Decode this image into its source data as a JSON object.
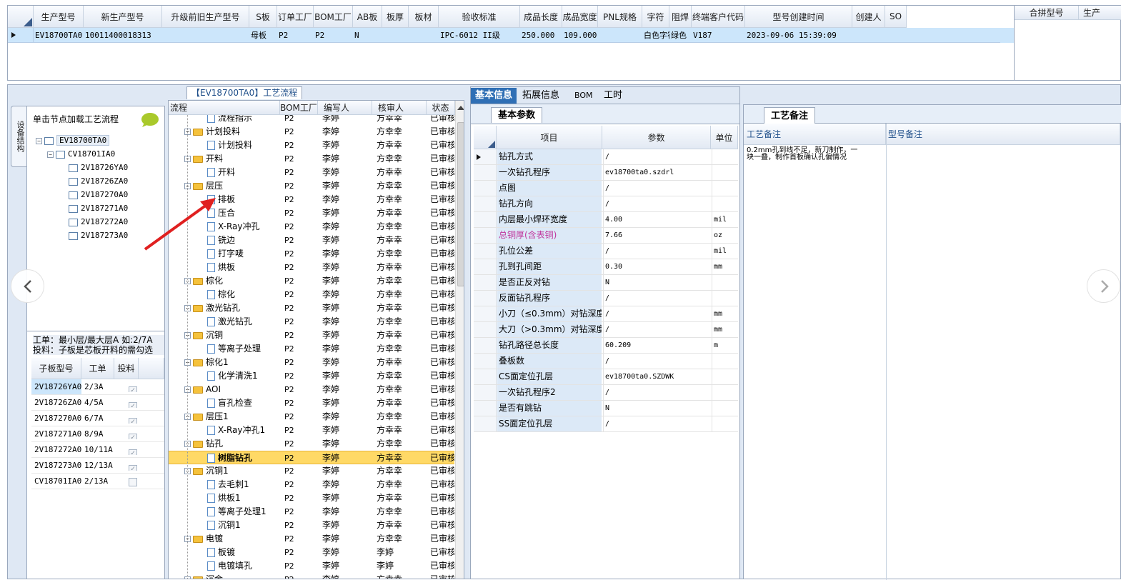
{
  "top": {
    "columns": [
      "生产型号",
      "新生产型号",
      "升级前旧生产型号",
      "S板",
      "订单工厂",
      "BOM工厂",
      "AB板",
      "板厚",
      "板材",
      "验收标准",
      "成品长度",
      "成品宽度",
      "PNL规格",
      "字符",
      "阻焊",
      "终端客户代码",
      "型号创建时间",
      "创建人",
      "SO"
    ],
    "row": [
      "EV18700TA0",
      "10011400018313",
      "",
      "母板",
      "P2",
      "P2",
      "N",
      "",
      "",
      "IPC-6012 II级",
      "250.000",
      "109.000",
      "",
      "白色字符",
      "绿色",
      "V187",
      "2023-09-06 15:39:09",
      "",
      ""
    ],
    "side_columns": [
      "合拼型号",
      "生产"
    ]
  },
  "left": {
    "vertical_tab": "设备结构",
    "hint": "单击节点加载工艺流程",
    "tree": [
      {
        "label": "EV18700TA0",
        "level": 0
      },
      {
        "label": "CV18701IA0",
        "level": 1
      },
      {
        "label": "2V18726YA0",
        "level": 2
      },
      {
        "label": "2V18726ZA0",
        "level": 2
      },
      {
        "label": "2V187270A0",
        "level": 2
      },
      {
        "label": "2V187271A0",
        "level": 2
      },
      {
        "label": "2V187272A0",
        "level": 2
      },
      {
        "label": "2V187273A0",
        "level": 2
      }
    ],
    "note_line1": "工单：最小层/最大层A 如:2/7A",
    "note_line2": "投料：子板是芯板开料的需勾选",
    "sub_columns": [
      "子板型号",
      "工单",
      "投料"
    ],
    "sub_rows": [
      {
        "model": "2V18726YA0",
        "order": "2/3A",
        "checked": true
      },
      {
        "model": "2V18726ZA0",
        "order": "4/5A",
        "checked": true
      },
      {
        "model": "2V187270A0",
        "order": "6/7A",
        "checked": true
      },
      {
        "model": "2V187271A0",
        "order": "8/9A",
        "checked": true
      },
      {
        "model": "2V187272A0",
        "order": "10/11A",
        "checked": true
      },
      {
        "model": "2V187273A0",
        "order": "12/13A",
        "checked": true
      },
      {
        "model": "CV18701IA0",
        "order": "2/13A",
        "checked": false
      }
    ]
  },
  "flow": {
    "title": "【EV18700TA0】工艺流程",
    "columns": [
      "流程",
      "BOM工厂",
      "编写人",
      "核审人",
      "状态"
    ],
    "rows": [
      {
        "name": "流程指示",
        "type": "doc",
        "f": "P2",
        "w": "李婷",
        "r": "方幸幸",
        "s": "已审核"
      },
      {
        "name": "计划投料",
        "type": "folder",
        "f": "P2",
        "w": "李婷",
        "r": "方幸幸",
        "s": "已审核"
      },
      {
        "name": "计划投料",
        "type": "doc",
        "f": "P2",
        "w": "李婷",
        "r": "方幸幸",
        "s": "已审核"
      },
      {
        "name": "开料",
        "type": "folder",
        "f": "P2",
        "w": "李婷",
        "r": "方幸幸",
        "s": "已审核"
      },
      {
        "name": "开料",
        "type": "doc",
        "f": "P2",
        "w": "李婷",
        "r": "方幸幸",
        "s": "已审核"
      },
      {
        "name": "层压",
        "type": "folder",
        "f": "P2",
        "w": "李婷",
        "r": "方幸幸",
        "s": "已审核"
      },
      {
        "name": "排板",
        "type": "doc",
        "f": "P2",
        "w": "李婷",
        "r": "方幸幸",
        "s": "已审核"
      },
      {
        "name": "压合",
        "type": "doc",
        "f": "P2",
        "w": "李婷",
        "r": "方幸幸",
        "s": "已审核"
      },
      {
        "name": "X-Ray冲孔",
        "type": "doc",
        "f": "P2",
        "w": "李婷",
        "r": "方幸幸",
        "s": "已审核"
      },
      {
        "name": "铣边",
        "type": "doc",
        "f": "P2",
        "w": "李婷",
        "r": "方幸幸",
        "s": "已审核"
      },
      {
        "name": "打字唛",
        "type": "doc",
        "f": "P2",
        "w": "李婷",
        "r": "方幸幸",
        "s": "已审核"
      },
      {
        "name": "烘板",
        "type": "doc",
        "f": "P2",
        "w": "李婷",
        "r": "方幸幸",
        "s": "已审核"
      },
      {
        "name": "棕化",
        "type": "folder",
        "f": "P2",
        "w": "李婷",
        "r": "方幸幸",
        "s": "已审核"
      },
      {
        "name": "棕化",
        "type": "doc",
        "f": "P2",
        "w": "李婷",
        "r": "方幸幸",
        "s": "已审核"
      },
      {
        "name": "激光钻孔",
        "type": "folder",
        "f": "P2",
        "w": "李婷",
        "r": "方幸幸",
        "s": "已审核"
      },
      {
        "name": "激光钻孔",
        "type": "doc",
        "f": "P2",
        "w": "李婷",
        "r": "方幸幸",
        "s": "已审核"
      },
      {
        "name": "沉铜",
        "type": "folder",
        "f": "P2",
        "w": "李婷",
        "r": "方幸幸",
        "s": "已审核"
      },
      {
        "name": "等离子处理",
        "type": "doc",
        "f": "P2",
        "w": "李婷",
        "r": "方幸幸",
        "s": "已审核"
      },
      {
        "name": "棕化1",
        "type": "folder",
        "f": "P2",
        "w": "李婷",
        "r": "方幸幸",
        "s": "已审核"
      },
      {
        "name": "化学清洗1",
        "type": "doc",
        "f": "P2",
        "w": "李婷",
        "r": "方幸幸",
        "s": "已审核"
      },
      {
        "name": "AOI",
        "type": "folder",
        "f": "P2",
        "w": "李婷",
        "r": "方幸幸",
        "s": "已审核"
      },
      {
        "name": "盲孔检查",
        "type": "doc",
        "f": "P2",
        "w": "李婷",
        "r": "方幸幸",
        "s": "已审核"
      },
      {
        "name": "层压1",
        "type": "folder",
        "f": "P2",
        "w": "李婷",
        "r": "方幸幸",
        "s": "已审核"
      },
      {
        "name": "X-Ray冲孔1",
        "type": "doc",
        "f": "P2",
        "w": "李婷",
        "r": "方幸幸",
        "s": "已审核"
      },
      {
        "name": "钻孔",
        "type": "folder",
        "f": "P2",
        "w": "李婷",
        "r": "方幸幸",
        "s": "已审核"
      },
      {
        "name": "树脂钻孔",
        "type": "doc",
        "f": "P2",
        "w": "李婷",
        "r": "方幸幸",
        "s": "已审核",
        "sel": true
      },
      {
        "name": "沉铜1",
        "type": "folder",
        "f": "P2",
        "w": "李婷",
        "r": "方幸幸",
        "s": "已审核"
      },
      {
        "name": "去毛刺1",
        "type": "doc",
        "f": "P2",
        "w": "李婷",
        "r": "方幸幸",
        "s": "已审核"
      },
      {
        "name": "烘板1",
        "type": "doc",
        "f": "P2",
        "w": "李婷",
        "r": "方幸幸",
        "s": "已审核"
      },
      {
        "name": "等离子处理1",
        "type": "doc",
        "f": "P2",
        "w": "李婷",
        "r": "方幸幸",
        "s": "已审核"
      },
      {
        "name": "沉铜1",
        "type": "doc",
        "f": "P2",
        "w": "李婷",
        "r": "方幸幸",
        "s": "已审核"
      },
      {
        "name": "电镀",
        "type": "folder",
        "f": "P2",
        "w": "李婷",
        "r": "方幸幸",
        "s": "已审核"
      },
      {
        "name": "板镀",
        "type": "doc",
        "f": "P2",
        "w": "李婷",
        "r": "李婷",
        "s": "已审核"
      },
      {
        "name": "电镀填孔",
        "type": "doc",
        "f": "P2",
        "w": "李婷",
        "r": "李婷",
        "s": "已审核"
      },
      {
        "name": "沉金",
        "type": "folder",
        "f": "P2",
        "w": "李婷",
        "r": "方幸幸",
        "s": "已审核"
      }
    ]
  },
  "detail": {
    "tabs": [
      "基本信息",
      "拓展信息",
      "BOM",
      "工时"
    ],
    "subtab": "基本参数",
    "columns": [
      "项目",
      "参数",
      "单位"
    ],
    "rows": [
      {
        "item": "钻孔方式",
        "param": "/",
        "unit": ""
      },
      {
        "item": "一次钻孔程序",
        "param": "ev18700ta0.szdrl",
        "unit": ""
      },
      {
        "item": "点图",
        "param": "/",
        "unit": ""
      },
      {
        "item": "钻孔方向",
        "param": "/",
        "unit": ""
      },
      {
        "item": "内层最小焊环宽度",
        "param": "4.00",
        "unit": "mil"
      },
      {
        "item": "总铜厚(含表铜)",
        "param": "7.66",
        "unit": "oz",
        "pink": true
      },
      {
        "item": "孔位公差",
        "param": "/",
        "unit": "mil"
      },
      {
        "item": "孔到孔间距",
        "param": "0.30",
        "unit": "mm"
      },
      {
        "item": "是否正反对钻",
        "param": "N",
        "unit": ""
      },
      {
        "item": "反面钻孔程序",
        "param": "/",
        "unit": ""
      },
      {
        "item": "小刀（≤0.3mm）对钻深度",
        "param": "/",
        "unit": "mm"
      },
      {
        "item": "大刀（>0.3mm）对钻深度",
        "param": "/",
        "unit": "mm"
      },
      {
        "item": "钻孔路径总长度",
        "param": "60.209",
        "unit": "m"
      },
      {
        "item": "叠板数",
        "param": "/",
        "unit": ""
      },
      {
        "item": "CS面定位孔层",
        "param": "ev18700ta0.SZDWK",
        "unit": ""
      },
      {
        "item": "一次钻孔程序2",
        "param": "/",
        "unit": ""
      },
      {
        "item": "是否有跳钻",
        "param": "N",
        "unit": ""
      },
      {
        "item": "SS面定位孔层",
        "param": "/",
        "unit": ""
      }
    ]
  },
  "remarks": {
    "tab": "工艺备注",
    "col1": "工艺备注",
    "col2": "型号备注",
    "text_line1": "0.2mm孔到线不足，新刀制作，一",
    "text_line2": "块一叠，制作首板确认孔偏情况"
  },
  "colors": {
    "selected_row": "#cce6fb",
    "highlight_row": "#ffd966",
    "frame": "#9aa8bd",
    "accent_tab": "#2f6fb5",
    "pink_text": "#c0359c",
    "arrow": "#e02020"
  }
}
